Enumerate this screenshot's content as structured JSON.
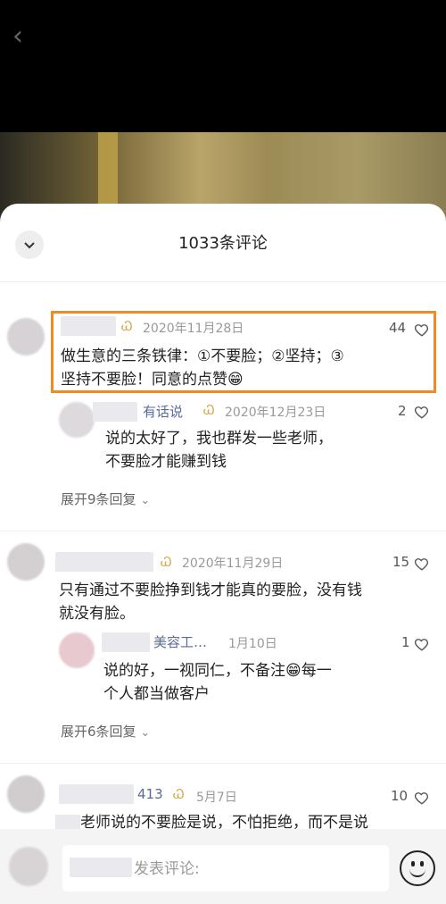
{
  "nav": {
    "back_icon": "chevron-left-icon"
  },
  "sheet": {
    "title": "1033条评论",
    "collapse_icon": "chevron-down-icon"
  },
  "comments": [
    {
      "badge": "᷵",
      "date": "2020年11月28日",
      "likes": "44",
      "text_line1": "做生意的三条铁律：①不要脸；②坚持；③",
      "text_line2": "坚持不要脸！同意的点赞😁",
      "reply": {
        "name": "有话说",
        "date": "2020年12月23日",
        "likes": "2",
        "text_line1": "说的太好了，我也群发一些老师，",
        "text_line2": "不要脸才能赚到钱"
      },
      "expand": "展开9条回复"
    },
    {
      "date": "2020年11月29日",
      "likes": "15",
      "text_line1": "只有通过不要脸挣到钱才能真的要脸，没有钱",
      "text_line2": "就没有脸。",
      "reply": {
        "name": "美容工…",
        "date": "1月10日",
        "likes": "1",
        "text_line1": "说的好，一视同仁，不备注😁每一",
        "text_line2": "个人都当做客户"
      },
      "expand": "展开6条回复"
    },
    {
      "name": "413",
      "date": "5月7日",
      "likes": "10",
      "text_line1": "老师说的不要脸是说，不怕拒绝，而不是说"
    }
  ],
  "composer": {
    "placeholder": "发表评论:",
    "emoji_icon": "smiley-icon"
  }
}
